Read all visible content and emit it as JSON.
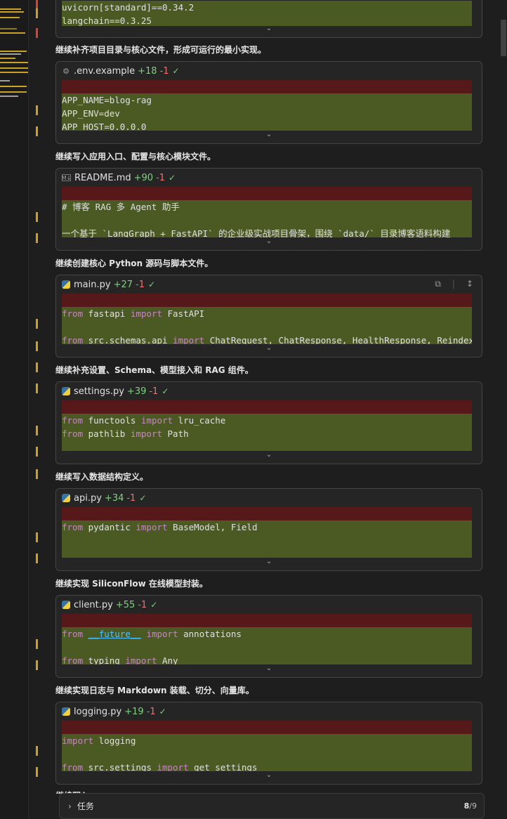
{
  "top_card": {
    "lines": [
      "uvicorn[standard]==0.34.2",
      "langchain==0.3.25"
    ]
  },
  "blocks": [
    {
      "caption": "继续补齐项目目录与核心文件，形成可运行的最小实现。",
      "file": ".env.example",
      "add": "+18",
      "del": "-1",
      "icon": "gear-icon",
      "lines": [
        [
          {
            "t": ""
          }
        ],
        [
          {
            "t": "APP_NAME=blog-rag"
          }
        ],
        [
          {
            "t": "APP_ENV=dev"
          }
        ],
        [
          {
            "t": "APP_HOST=0.0.0.0"
          }
        ]
      ]
    },
    {
      "caption": "继续写入应用入口、配置与核心模块文件。",
      "file": "README.md",
      "add": "+90",
      "del": "-1",
      "icon": "markdown-icon",
      "lines": [
        [
          {
            "t": ""
          }
        ],
        [
          {
            "t": "# 博客 RAG 多 Agent 助手"
          }
        ],
        [
          {
            "t": ""
          }
        ],
        [
          {
            "t": "一个基于 `LangGraph + FastAPI` 的企业级实战项目骨架，围绕 `data/` 目录博客语料构建"
          }
        ]
      ]
    },
    {
      "caption": "继续创建核心 Python 源码与脚本文件。",
      "file": "main.py",
      "add": "+27",
      "del": "-1",
      "icon": "python-icon",
      "tools": true,
      "lines": [
        [
          {
            "t": ""
          }
        ],
        [
          {
            "t": "from",
            "k": 1
          },
          {
            "t": " fastapi "
          },
          {
            "t": "import",
            "k": 1
          },
          {
            "t": " FastAPI"
          }
        ],
        [
          {
            "t": ""
          }
        ],
        [
          {
            "t": "from",
            "k": 1
          },
          {
            "t": " src.schemas.api "
          },
          {
            "t": "import",
            "k": 1
          },
          {
            "t": " ChatRequest, ChatResponse, HealthResponse, ReindexResp"
          }
        ]
      ]
    },
    {
      "caption": "继续补充设置、Schema、模型接入和 RAG 组件。",
      "file": "settings.py",
      "add": "+39",
      "del": "-1",
      "icon": "python-icon",
      "lines": [
        [
          {
            "t": ""
          }
        ],
        [
          {
            "t": "from",
            "k": 1
          },
          {
            "t": " functools "
          },
          {
            "t": "import",
            "k": 1
          },
          {
            "t": " lru_cache"
          }
        ],
        [
          {
            "t": "from",
            "k": 1
          },
          {
            "t": " pathlib "
          },
          {
            "t": "import",
            "k": 1
          },
          {
            "t": " Path"
          }
        ],
        [
          {
            "t": ""
          }
        ]
      ]
    },
    {
      "caption": "继续写入数据结构定义。",
      "file": "api.py",
      "add": "+34",
      "del": "-1",
      "icon": "python-icon",
      "lines": [
        [
          {
            "t": ""
          }
        ],
        [
          {
            "t": "from",
            "k": 1
          },
          {
            "t": " pydantic "
          },
          {
            "t": "import",
            "k": 1
          },
          {
            "t": " BaseModel, Field"
          }
        ],
        [
          {
            "t": ""
          }
        ],
        [
          {
            "t": ""
          }
        ]
      ]
    },
    {
      "caption": "继续实现 SiliconFlow 在线模型封装。",
      "file": "client.py",
      "add": "+55",
      "del": "-1",
      "icon": "python-icon",
      "lines": [
        [
          {
            "t": ""
          }
        ],
        [
          {
            "t": "from",
            "k": 1
          },
          {
            "t": " "
          },
          {
            "t": "__future__",
            "f": 1
          },
          {
            "t": " "
          },
          {
            "t": "import",
            "k": 1
          },
          {
            "t": " annotations"
          }
        ],
        [
          {
            "t": ""
          }
        ],
        [
          {
            "t": "from",
            "k": 1
          },
          {
            "t": " typing "
          },
          {
            "t": "import",
            "k": 1
          },
          {
            "t": " Any"
          }
        ]
      ]
    },
    {
      "caption": "继续实现日志与 Markdown 装载、切分、向量库。",
      "file": "logging.py",
      "add": "+19",
      "del": "-1",
      "icon": "python-icon",
      "lines": [
        [
          {
            "t": ""
          }
        ],
        [
          {
            "t": "import",
            "k": 1
          },
          {
            "t": " logging"
          }
        ],
        [
          {
            "t": ""
          }
        ],
        [
          {
            "t": "from",
            "k": 1
          },
          {
            "t": " src.settings "
          },
          {
            "t": "import",
            "k": 1
          },
          {
            "t": " get_settings"
          }
        ]
      ]
    }
  ],
  "bottom_bar": {
    "label": "任务",
    "count_done": "8",
    "count_total": "/9"
  },
  "colors": {
    "added_bg": "#4b5a22",
    "removed_bg": "#561819",
    "keyword": "#c586c0"
  }
}
